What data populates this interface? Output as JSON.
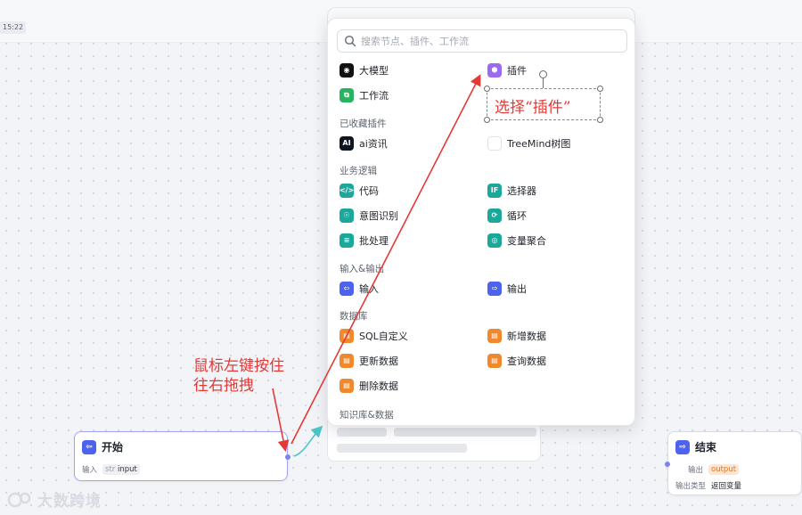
{
  "canvas": {
    "time_tag": "15:22"
  },
  "popup": {
    "search_placeholder": "搜索节点、插件、工作流",
    "top_items": [
      {
        "label": "大模型",
        "icon": "llm-icon",
        "color": "#111111"
      },
      {
        "label": "插件",
        "icon": "plugin-icon",
        "color": "#9a6bf0"
      },
      {
        "label": "工作流",
        "icon": "workflow-icon",
        "color": "#27b35f"
      }
    ],
    "sections": {
      "favorites": "已收藏插件",
      "business": "业务逻辑",
      "io": "输入&输出",
      "database": "数据库",
      "knowledge": "知识库&数据"
    },
    "favorites": [
      {
        "label": "ai资讯",
        "icon": "ai-news-icon"
      },
      {
        "label": "TreeMind树图",
        "icon": "treemind-icon"
      }
    ],
    "business": [
      {
        "label": "代码",
        "icon": "code-icon"
      },
      {
        "label": "选择器",
        "icon": "if-selector-icon"
      },
      {
        "label": "意图识别",
        "icon": "intent-icon"
      },
      {
        "label": "循环",
        "icon": "loop-icon"
      },
      {
        "label": "批处理",
        "icon": "batch-icon"
      },
      {
        "label": "变量聚合",
        "icon": "variable-merge-icon"
      }
    ],
    "io": [
      {
        "label": "输入",
        "icon": "input-icon"
      },
      {
        "label": "输出",
        "icon": "output-icon"
      }
    ],
    "database": [
      {
        "label": "SQL自定义",
        "icon": "sql-icon"
      },
      {
        "label": "新增数据",
        "icon": "add-data-icon"
      },
      {
        "label": "更新数据",
        "icon": "update-data-icon"
      },
      {
        "label": "查询数据",
        "icon": "query-data-icon"
      },
      {
        "label": "删除数据",
        "icon": "delete-data-icon"
      }
    ]
  },
  "annotations": {
    "select_plugin": "选择“插件”",
    "drag_hint": "鼠标左键按住\n往右拖拽",
    "color": "#e53935"
  },
  "nodes": {
    "start": {
      "title": "开始",
      "input_label": "输入",
      "input_type": "str",
      "input_value": "input"
    },
    "end": {
      "title": "结束",
      "output_label": "输出",
      "output_value": "output",
      "output_type_label": "输出类型",
      "output_type_value": "返回变量"
    }
  },
  "watermark": {
    "text": "大数跨境"
  }
}
